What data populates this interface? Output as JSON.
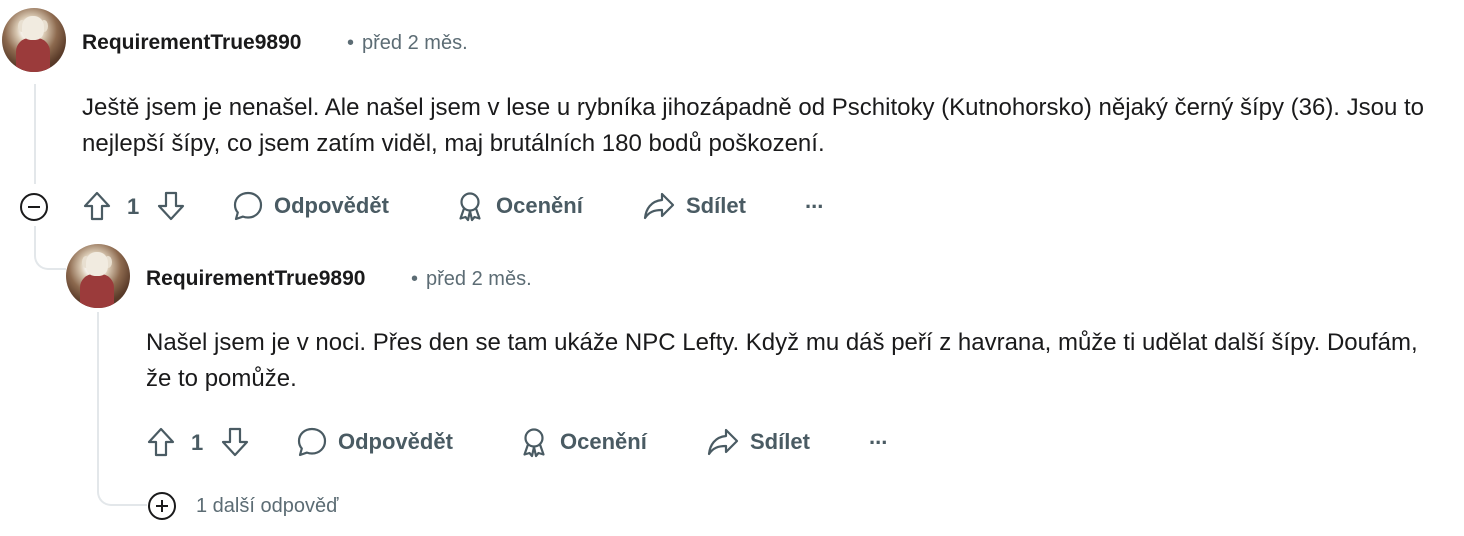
{
  "comments": [
    {
      "author": "RequirementTrue9890",
      "time": "před 2 měs.",
      "text": "Ještě jsem je nenašel. Ale našel jsem v lese u rybníka jihozápadně od Pschitoky (Kutnohorsko) nějaký černý šípy (36). Jsou to nejlepší šípy, co jsem zatím viděl, maj brutálních 180 bodů poškození.",
      "votes": "1",
      "actions": {
        "reply": "Odpovědět",
        "award": "Ocenění",
        "share": "Sdílet",
        "more": "..."
      }
    },
    {
      "author": "RequirementTrue9890",
      "time": "před 2 měs.",
      "text": "Našel jsem je v noci. Přes den se tam ukáže NPC Lefty. Když mu dáš peří z havrana, může ti udělat další šípy. Doufám, že to pomůže.",
      "votes": "1",
      "actions": {
        "reply": "Odpovědět",
        "award": "Ocenění",
        "share": "Sdílet",
        "more": "..."
      }
    }
  ],
  "more_replies": "1 další odpověď",
  "icons": {
    "collapse": "minus-circle-icon",
    "expand": "plus-circle-icon",
    "upvote": "arrow-up-icon",
    "downvote": "arrow-down-icon",
    "reply": "speech-bubble-icon",
    "award": "award-icon",
    "share": "share-arrow-icon",
    "more": "ellipsis-icon"
  },
  "colors": {
    "text": "#1a1a1b",
    "muted": "#5c6c74",
    "action": "#4a5b63",
    "thread": "#e3e7ea"
  }
}
